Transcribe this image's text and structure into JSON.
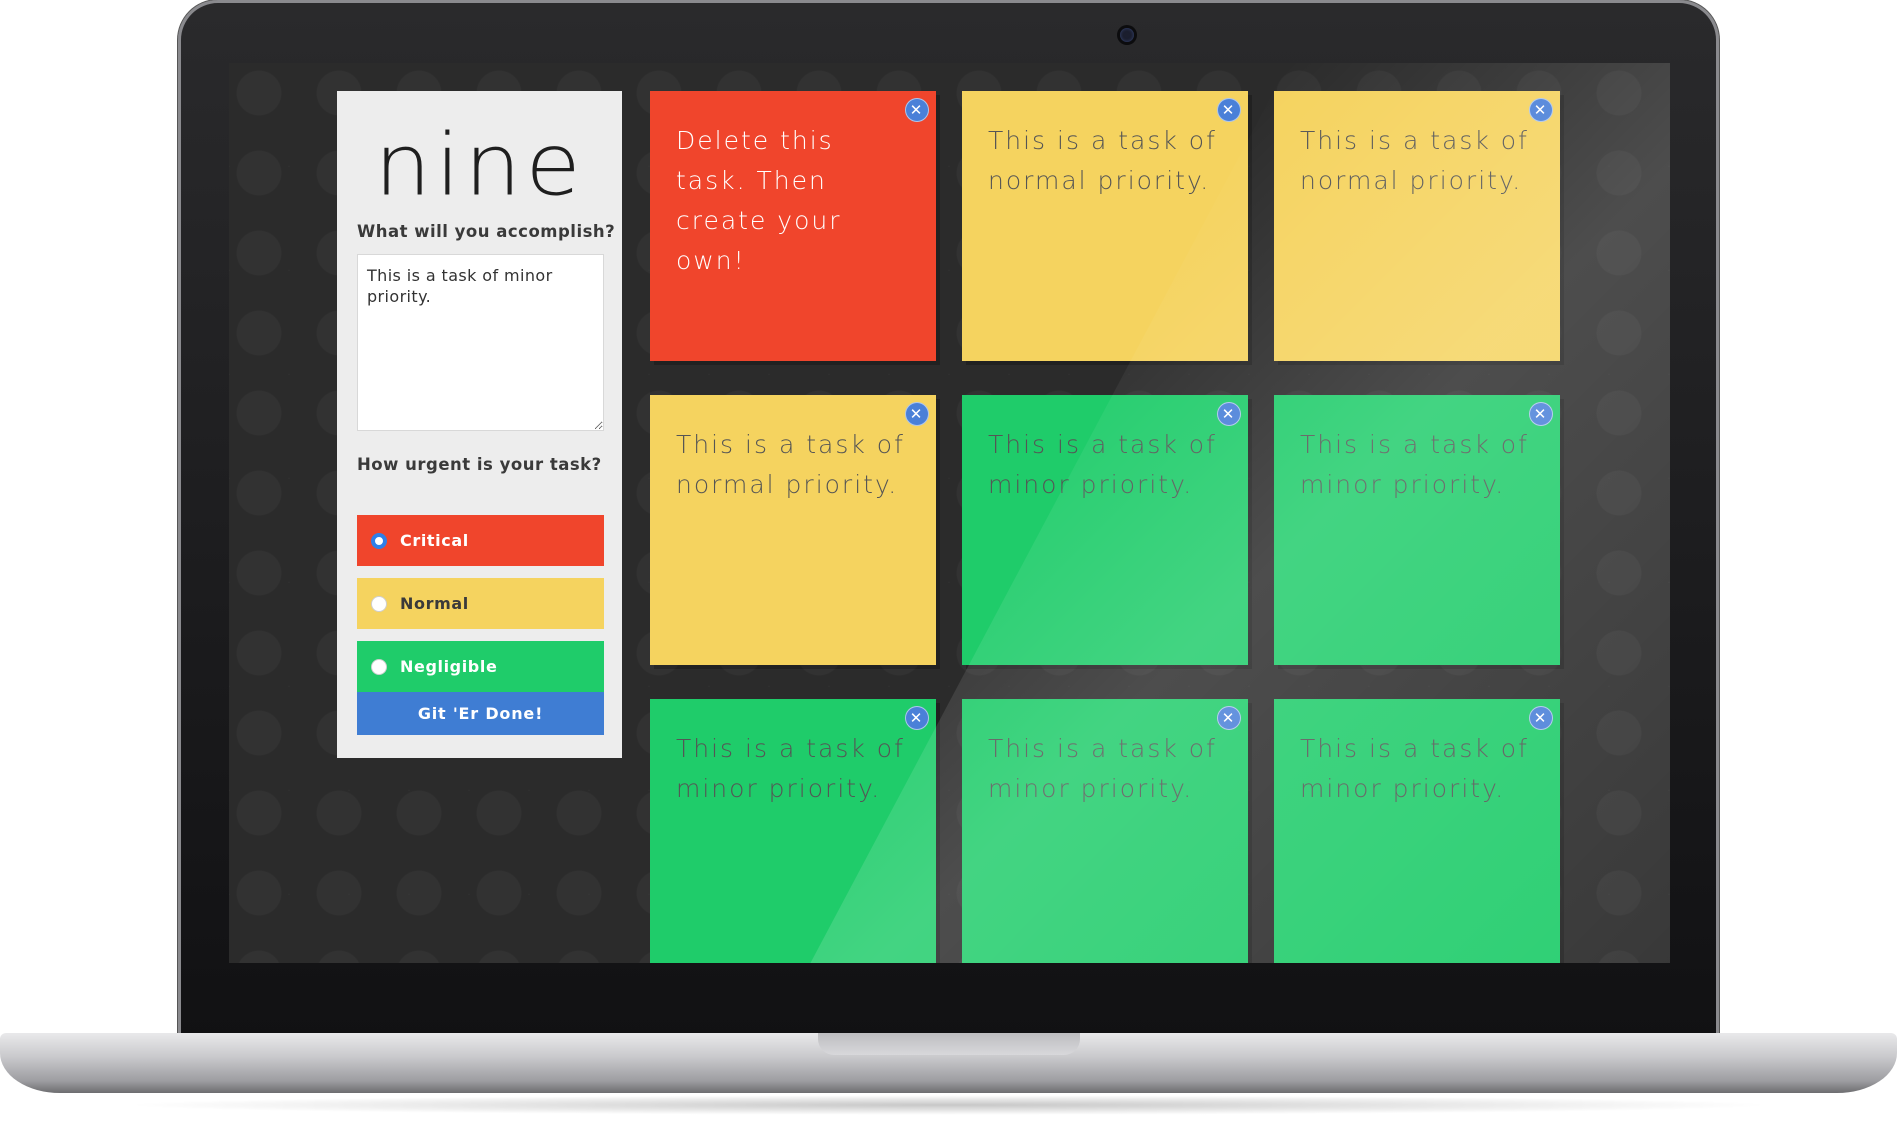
{
  "app": {
    "logo": "nine",
    "prompt_label": "What will you accomplish?",
    "task_input_value": "This is a task of minor priority.",
    "urgency_label": "How urgent is your task?",
    "options": [
      {
        "label": "Critical",
        "color": "#f0452c",
        "text_color": "#ffffff",
        "checked": true
      },
      {
        "label": "Normal",
        "color": "#f5d35f",
        "text_color": "#3a3a3a",
        "checked": false
      },
      {
        "label": "Negligible",
        "color": "#1fcc6a",
        "text_color": "#ffffff",
        "checked": false
      }
    ],
    "submit_label": "Git 'Er Done!"
  },
  "cards": [
    {
      "text": "Delete this task. Then create your own!",
      "priority": "critical",
      "color": "#f0452c",
      "text_color": "#ffffff"
    },
    {
      "text": "This is a task of normal priority.",
      "priority": "normal",
      "color": "#f5d35f",
      "text_color": "#555555"
    },
    {
      "text": "This is a task of normal priority.",
      "priority": "normal",
      "color": "#f5d35f",
      "text_color": "#555555"
    },
    {
      "text": "This is a task of normal priority.",
      "priority": "normal",
      "color": "#f5d35f",
      "text_color": "#555555"
    },
    {
      "text": "This is a task of minor priority.",
      "priority": "minor",
      "color": "#1fcc6a",
      "text_color": "#555555"
    },
    {
      "text": "This is a task of minor priority.",
      "priority": "minor",
      "color": "#1fcc6a",
      "text_color": "#555555"
    },
    {
      "text": "This is a task of minor priority.",
      "priority": "minor",
      "color": "#1fcc6a",
      "text_color": "#555555"
    },
    {
      "text": "This is a task of minor priority.",
      "priority": "minor",
      "color": "#1fcc6a",
      "text_color": "#555555"
    },
    {
      "text": "This is a task of minor priority.",
      "priority": "minor",
      "color": "#1fcc6a",
      "text_color": "#555555"
    }
  ],
  "icons": {
    "card_close": "close-icon",
    "camera": "camera-icon"
  }
}
